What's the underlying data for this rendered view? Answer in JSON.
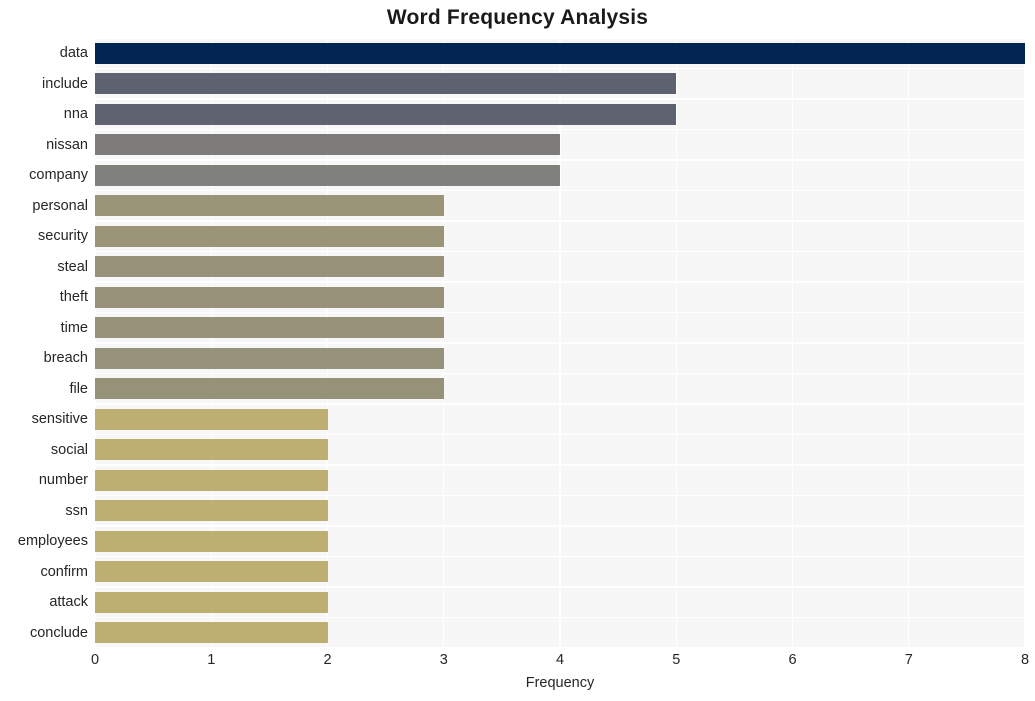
{
  "chart_data": {
    "type": "bar",
    "orientation": "horizontal",
    "title": "Word Frequency Analysis",
    "xlabel": "Frequency",
    "ylabel": "",
    "xlim": [
      0,
      8
    ],
    "xticks": [
      "0",
      "1",
      "2",
      "3",
      "4",
      "5",
      "6",
      "7",
      "8"
    ],
    "grid": true,
    "legend": null,
    "plot_background": "#f7f7f7",
    "grid_color": "#ffffff",
    "categories": [
      "data",
      "include",
      "nna",
      "nissan",
      "company",
      "personal",
      "security",
      "steal",
      "theft",
      "time",
      "breach",
      "file",
      "sensitive",
      "social",
      "number",
      "ssn",
      "employees",
      "confirm",
      "attack",
      "conclude"
    ],
    "values": [
      8,
      5,
      5,
      4,
      4,
      3,
      3,
      3,
      3,
      3,
      3,
      3,
      2,
      2,
      2,
      2,
      2,
      2,
      2,
      2
    ],
    "bar_colors": [
      "#032552",
      "#5d6170",
      "#5f6371",
      "#7d7c7a",
      "#80807d",
      "#9a9478",
      "#9a9478",
      "#98927a",
      "#98927a",
      "#98927a",
      "#97927c",
      "#969179",
      "#bdae72",
      "#bdae72",
      "#bdae72",
      "#bdae72",
      "#bdae72",
      "#bdae72",
      "#bdae72",
      "#bdae72"
    ]
  }
}
